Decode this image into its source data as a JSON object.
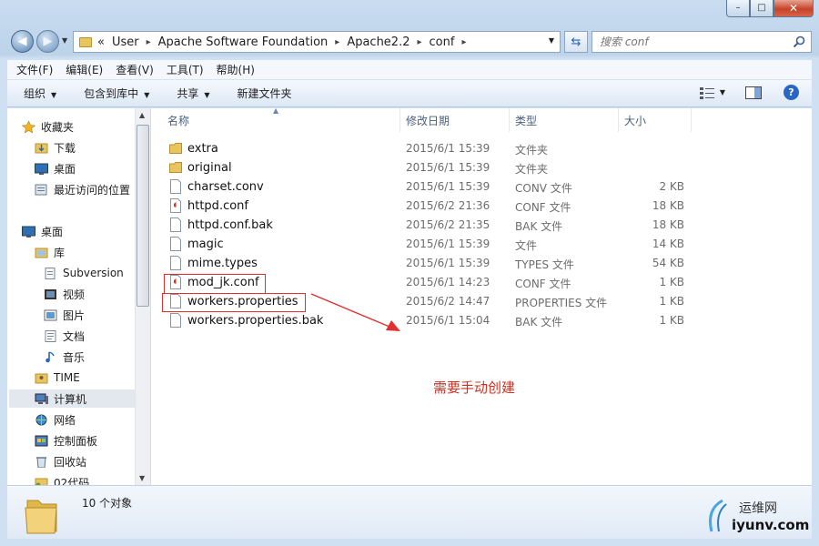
{
  "window": {
    "caption": {
      "minimize": "–",
      "maximize": "□",
      "close": "✕"
    }
  },
  "address": {
    "overflow": "«",
    "crumbs": [
      "User",
      "Apache Software Foundation",
      "Apache2.2",
      "conf"
    ],
    "search_placeholder": "搜索 conf"
  },
  "menu": [
    "文件(F)",
    "编辑(E)",
    "查看(V)",
    "工具(T)",
    "帮助(H)"
  ],
  "toolbar": {
    "organize": "组织",
    "include_library": "包含到库中",
    "share": "共享",
    "new_folder": "新建文件夹"
  },
  "sidebar": {
    "items": [
      {
        "label": "收藏夹",
        "icon": "star-icon"
      },
      {
        "label": "下载",
        "icon": "download-folder-icon"
      },
      {
        "label": "桌面",
        "icon": "desktop-icon"
      },
      {
        "label": "最近访问的位置",
        "icon": "recent-places-icon"
      },
      {
        "label": "桌面",
        "icon": "desktop-icon"
      },
      {
        "label": "库",
        "icon": "library-icon"
      },
      {
        "label": "Subversion",
        "icon": "library-doc-icon"
      },
      {
        "label": "视频",
        "icon": "video-icon"
      },
      {
        "label": "图片",
        "icon": "picture-icon"
      },
      {
        "label": "文档",
        "icon": "document-icon"
      },
      {
        "label": "音乐",
        "icon": "music-icon"
      },
      {
        "label": "TIME",
        "icon": "user-folder-icon"
      },
      {
        "label": "计算机",
        "icon": "computer-icon"
      },
      {
        "label": "网络",
        "icon": "network-icon"
      },
      {
        "label": "控制面板",
        "icon": "control-panel-icon"
      },
      {
        "label": "回收站",
        "icon": "recycle-bin-icon"
      },
      {
        "label": "02代码",
        "icon": "folder-icon"
      }
    ]
  },
  "columns": {
    "name": "名称",
    "date": "修改日期",
    "type": "类型",
    "size": "大小"
  },
  "files": [
    {
      "name": "extra",
      "date": "2015/6/1 15:39",
      "type": "文件夹",
      "size": "",
      "icon": "folder-icon"
    },
    {
      "name": "original",
      "date": "2015/6/1 15:39",
      "type": "文件夹",
      "size": "",
      "icon": "folder-icon"
    },
    {
      "name": "charset.conv",
      "date": "2015/6/1 15:39",
      "type": "CONV 文件",
      "size": "2 KB",
      "icon": "file-icon"
    },
    {
      "name": "httpd.conf",
      "date": "2015/6/2 21:36",
      "type": "CONF 文件",
      "size": "18 KB",
      "icon": "conf-file-icon"
    },
    {
      "name": "httpd.conf.bak",
      "date": "2015/6/2 21:35",
      "type": "BAK 文件",
      "size": "18 KB",
      "icon": "file-icon"
    },
    {
      "name": "magic",
      "date": "2015/6/1 15:39",
      "type": "文件",
      "size": "14 KB",
      "icon": "file-icon"
    },
    {
      "name": "mime.types",
      "date": "2015/6/1 15:39",
      "type": "TYPES 文件",
      "size": "54 KB",
      "icon": "file-icon"
    },
    {
      "name": "mod_jk.conf",
      "date": "2015/6/1 14:23",
      "type": "CONF 文件",
      "size": "1 KB",
      "icon": "conf-file-icon"
    },
    {
      "name": "workers.properties",
      "date": "2015/6/2 14:47",
      "type": "PROPERTIES 文件",
      "size": "1 KB",
      "icon": "file-icon"
    },
    {
      "name": "workers.properties.bak",
      "date": "2015/6/1 15:04",
      "type": "BAK 文件",
      "size": "1 KB",
      "icon": "file-icon"
    }
  ],
  "annotation": {
    "note": "需要手动创建",
    "color": "#e03030"
  },
  "status": {
    "count": "10 个对象"
  },
  "watermark": {
    "line1": "运维网",
    "line2": "iyunv.com"
  }
}
